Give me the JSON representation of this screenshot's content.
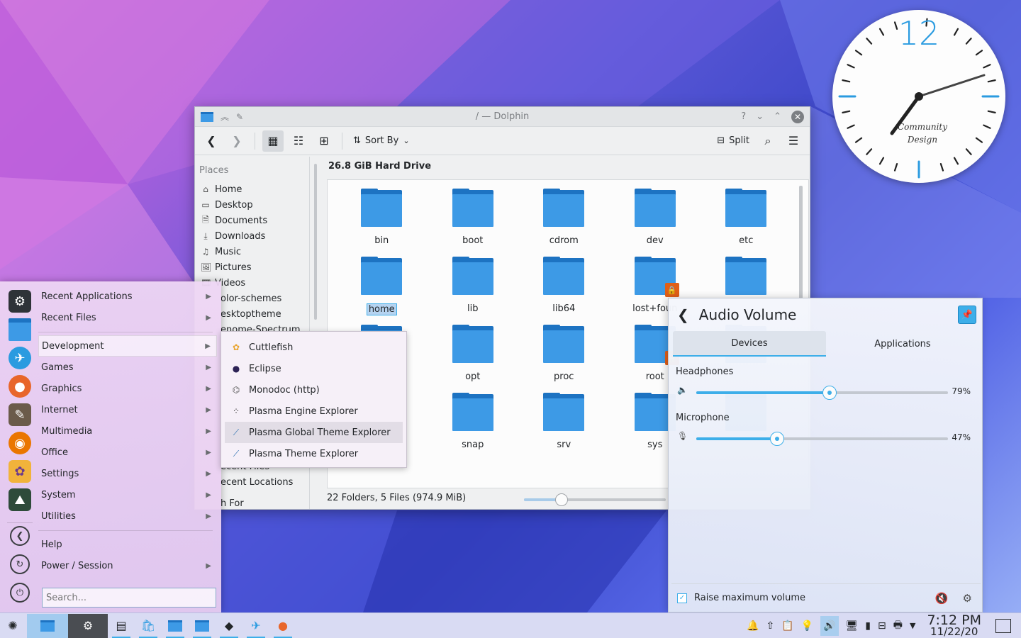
{
  "clock": {
    "number": "12",
    "brand_line1": "Community",
    "brand_line2": "Design"
  },
  "dolphin": {
    "title": "/ — Dolphin",
    "toolbar": {
      "sort_label": "Sort By",
      "split_label": "Split"
    },
    "places_heading": "Places",
    "places": [
      {
        "icon": "home-icon",
        "label": "Home"
      },
      {
        "icon": "desktop-icon",
        "label": "Desktop"
      },
      {
        "icon": "documents-icon",
        "label": "Documents"
      },
      {
        "icon": "downloads-icon",
        "label": "Downloads"
      },
      {
        "icon": "music-icon",
        "label": "Music"
      },
      {
        "icon": "pictures-icon",
        "label": "Pictures"
      },
      {
        "icon": "videos-icon",
        "label": "Videos"
      }
    ],
    "places_partial": [
      "olor-schemes",
      "esktoptheme",
      "enome-Spectrum"
    ],
    "places_lower": [
      "ecent Files",
      "ecent Locations",
      "h For"
    ],
    "content_heading": "26.8 GiB Hard Drive",
    "items": [
      {
        "name": "bin",
        "lock": false,
        "selected": false
      },
      {
        "name": "boot",
        "lock": false,
        "selected": false
      },
      {
        "name": "cdrom",
        "lock": false,
        "selected": false
      },
      {
        "name": "dev",
        "lock": false,
        "selected": false
      },
      {
        "name": "etc",
        "lock": false,
        "selected": false
      },
      {
        "name": "home",
        "lock": false,
        "selected": true
      },
      {
        "name": "lib",
        "lock": false,
        "selected": false
      },
      {
        "name": "lib64",
        "lock": false,
        "selected": false
      },
      {
        "name": "lost+foun",
        "lock": true,
        "selected": false
      },
      {
        "name": "",
        "lock": false,
        "selected": false
      },
      {
        "name": "",
        "lock": false,
        "selected": false
      },
      {
        "name": "opt",
        "lock": false,
        "selected": false
      },
      {
        "name": "proc",
        "lock": false,
        "selected": false
      },
      {
        "name": "root",
        "lock": true,
        "selected": false
      },
      {
        "name": "",
        "lock": false,
        "selected": false
      },
      {
        "name": "",
        "lock": false,
        "selected": false
      },
      {
        "name": "snap",
        "lock": false,
        "selected": false
      },
      {
        "name": "srv",
        "lock": false,
        "selected": false
      },
      {
        "name": "sys",
        "lock": false,
        "selected": false
      },
      {
        "name": "",
        "lock": false,
        "selected": false
      }
    ],
    "status": "22 Folders, 5 Files (974.9 MiB)"
  },
  "launcher": {
    "menu": [
      {
        "label": "Recent Applications",
        "arrow": true
      },
      {
        "label": "Recent Files",
        "arrow": true
      },
      {
        "label": "Development",
        "arrow": true,
        "highlight": true
      },
      {
        "label": "Games",
        "arrow": true
      },
      {
        "label": "Graphics",
        "arrow": true
      },
      {
        "label": "Internet",
        "arrow": true
      },
      {
        "label": "Multimedia",
        "arrow": true
      },
      {
        "label": "Office",
        "arrow": true
      },
      {
        "label": "Settings",
        "arrow": true
      },
      {
        "label": "System",
        "arrow": true
      },
      {
        "label": "Utilities",
        "arrow": true
      },
      {
        "label": "Help",
        "arrow": false
      },
      {
        "label": "Power / Session",
        "arrow": true
      }
    ],
    "search_placeholder": "Search...",
    "submenu": [
      {
        "label": "Cuttlefish",
        "icon": "cuttlefish-icon"
      },
      {
        "label": "Eclipse",
        "icon": "eclipse-icon"
      },
      {
        "label": "Monodoc (http)",
        "icon": "monodoc-icon"
      },
      {
        "label": "Plasma Engine Explorer",
        "icon": "plasma-engine-icon"
      },
      {
        "label": "Plasma Global Theme Explorer",
        "icon": "plasma-global-theme-icon",
        "highlight": true
      },
      {
        "label": "Plasma Theme Explorer",
        "icon": "plasma-theme-icon"
      }
    ]
  },
  "audio": {
    "title": "Audio Volume",
    "tabs": [
      "Devices",
      "Applications"
    ],
    "devices": [
      {
        "name": "Headphones",
        "percent_label": "79%",
        "level": 0.53
      },
      {
        "name": "Microphone",
        "percent_label": "47%",
        "level": 0.32
      }
    ],
    "raise_max_label": "Raise maximum volume"
  },
  "taskbar": {
    "time": "7:12 PM",
    "date": "11/22/20"
  },
  "colors": {
    "accent": "#3daee9",
    "folder": "#3d9ae6",
    "folder_tab": "#1d73c2",
    "lock": "#e05f18"
  }
}
